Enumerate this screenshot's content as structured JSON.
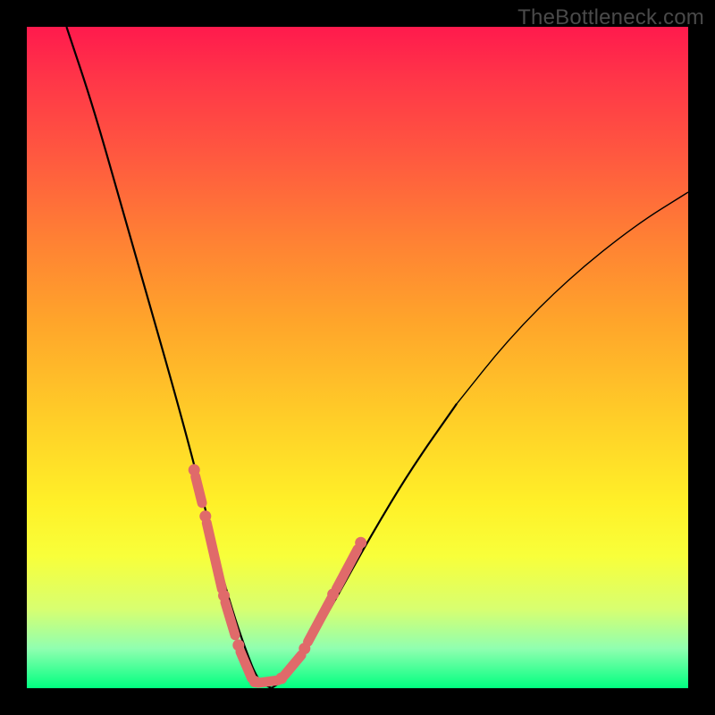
{
  "attribution": "TheBottleneck.com",
  "colors": {
    "gradient_top": "#ff1a4d",
    "gradient_bottom": "#00ff80",
    "curve": "#000000",
    "marker": "#e06a6a",
    "frame": "#000000"
  },
  "chart_data": {
    "type": "line",
    "title": "",
    "xlabel": "",
    "ylabel": "",
    "xlim": [
      0,
      100
    ],
    "ylim": [
      0,
      100
    ],
    "grid": false,
    "series": [
      {
        "name": "bottleneck-curve",
        "description": "V-shaped bottleneck curve; y approaches 0 near x≈35 and rises toward both sides",
        "x": [
          6,
          10,
          14,
          18,
          22,
          25,
          27,
          29,
          31,
          33,
          35,
          37,
          40,
          43,
          47,
          52,
          58,
          65,
          73,
          82,
          92,
          100
        ],
        "y": [
          100,
          88,
          74,
          60,
          46,
          35,
          27,
          19,
          12,
          6,
          1,
          0,
          2,
          7,
          14,
          23,
          33,
          43,
          53,
          62,
          70,
          75
        ]
      }
    ],
    "markers": {
      "description": "Salmon-colored emphasis segments/dots along the curve near the valley region",
      "segments": [
        {
          "x0": 25.5,
          "y0": 32,
          "x1": 26.5,
          "y1": 28
        },
        {
          "x0": 27.2,
          "y0": 25,
          "x1": 29.5,
          "y1": 15
        },
        {
          "x0": 30.0,
          "y0": 13,
          "x1": 31.5,
          "y1": 8
        },
        {
          "x0": 32.3,
          "y0": 5.5,
          "x1": 34.0,
          "y1": 1.5
        },
        {
          "x0": 35.0,
          "y0": 0.8,
          "x1": 38.0,
          "y1": 1.2
        },
        {
          "x0": 39.0,
          "y0": 2.0,
          "x1": 41.5,
          "y1": 5.0
        },
        {
          "x0": 42.5,
          "y0": 7.0,
          "x1": 46.0,
          "y1": 13.5
        },
        {
          "x0": 46.8,
          "y0": 15.0,
          "x1": 50.0,
          "y1": 21.0
        }
      ],
      "dots": [
        {
          "x": 25.3,
          "y": 33
        },
        {
          "x": 27.0,
          "y": 26
        },
        {
          "x": 29.8,
          "y": 14
        },
        {
          "x": 32.0,
          "y": 6.5
        },
        {
          "x": 34.5,
          "y": 1.0
        },
        {
          "x": 38.5,
          "y": 1.5
        },
        {
          "x": 42.0,
          "y": 6.0
        },
        {
          "x": 46.3,
          "y": 14.2
        },
        {
          "x": 50.5,
          "y": 22.0
        }
      ]
    }
  }
}
